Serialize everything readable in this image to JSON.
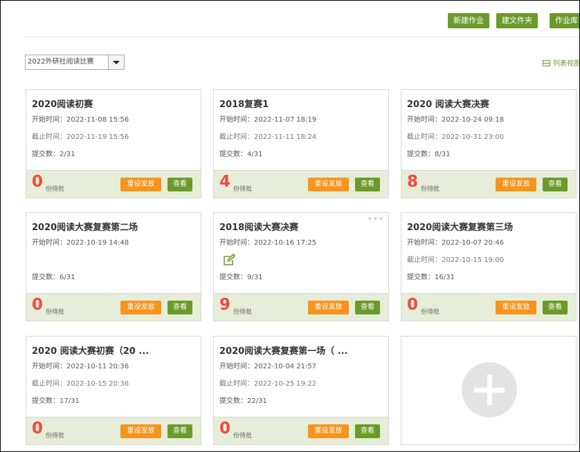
{
  "toolbar": {
    "new_assignment": "新建作业",
    "new_folder": "建文件夹",
    "library": "作业库"
  },
  "filter": {
    "selected": "2022外研社阅读比赛"
  },
  "list_view_label": "列表视图",
  "card_labels": {
    "start_prefix": "开始时间：",
    "end_prefix": "截止时间：",
    "submit_prefix": "提交数：",
    "pending": "份待批",
    "reset": "重设发放",
    "view": "查看"
  },
  "cards": [
    {
      "title": "2020阅读初赛",
      "start": "2022-11-08 15:56",
      "end": "2022-11-19 15:56",
      "submit": "2/31",
      "count": "0"
    },
    {
      "title": "2018复赛1",
      "start": "2022-11-07 18:19",
      "end": "2022-11-11 18:24",
      "submit": "4/31",
      "count": "4"
    },
    {
      "title": "2020 阅读大赛决赛",
      "start": "2022-10-24 09:18",
      "end": "2022-10-31 23:00",
      "submit": "8/31",
      "count": "8"
    },
    {
      "title": "2020阅读大赛复赛第二场",
      "start": "2022-10-19 14:48",
      "submit": "6/31",
      "count": "0"
    },
    {
      "title": "2018阅读大赛决赛",
      "start": "2022-10-16 17:25",
      "submit": "9/31",
      "count": "9"
    },
    {
      "title": "2020阅读大赛复赛第三场",
      "start": "2022-10-07 20:46",
      "end": "2022-10-15 19:00",
      "submit": "16/31",
      "count": "0"
    },
    {
      "title": "2020 阅读大赛初赛（20 ...",
      "start": "2022-10-11 20:36",
      "end": "2022-10-15 20:36",
      "submit": "17/31",
      "count": "0"
    },
    {
      "title": "2020阅读大赛复赛第一场（ ...",
      "start": "2022-10-04 21:57",
      "end": "2022-10-25 19:22",
      "submit": "22/31",
      "count": "0"
    }
  ]
}
